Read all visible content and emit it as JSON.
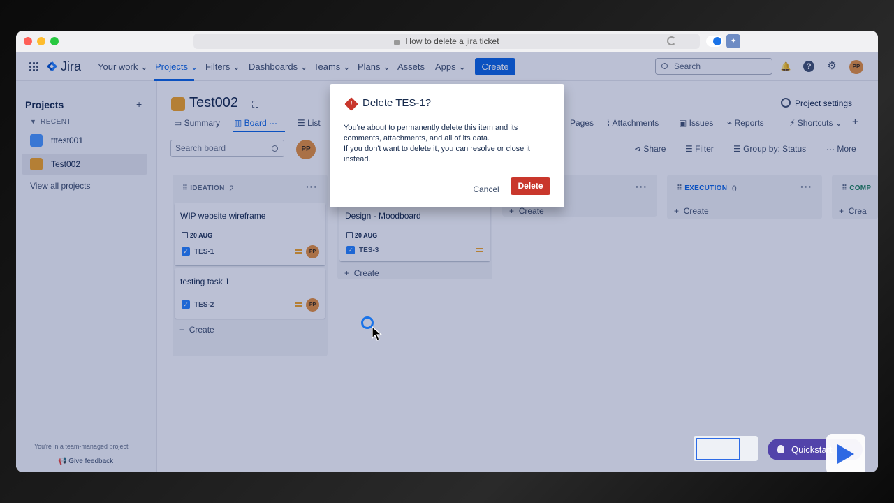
{
  "browser": {
    "url_title": "How to delete a jira ticket"
  },
  "topnav": {
    "logo": "Jira",
    "items": [
      "Your work",
      "Projects",
      "Filters",
      "Dashboards",
      "Teams",
      "Plans",
      "Assets",
      "Apps"
    ],
    "create_label": "Create",
    "search_placeholder": "Search",
    "avatar_initials": "PP"
  },
  "sidebar": {
    "title": "Projects",
    "add": "+",
    "recent_label": "RECENT",
    "projects": [
      "tttest001",
      "Test002"
    ],
    "view_all": "View all projects",
    "footer_note": "You're in a team-managed project",
    "feedback": "Give feedback"
  },
  "project": {
    "name": "Test002",
    "settings_label": "Project settings",
    "tabs": [
      "Summary",
      "Board",
      "List",
      "Pages",
      "Attachments",
      "Issues",
      "Reports",
      "Shortcuts"
    ],
    "board_search_placeholder": "Search board",
    "toolbar": [
      "Share",
      "Filter",
      "Group by: Status",
      "More"
    ]
  },
  "columns": [
    {
      "name": "IDEATION",
      "count": "2",
      "cards": [
        {
          "title": "WIP website wireframe",
          "date": "20 AUG",
          "key": "TES-1",
          "avatar": "PP"
        },
        {
          "title": "testing task 1",
          "date": "",
          "key": "TES-2",
          "avatar": "PP"
        }
      ],
      "create_label": "Create"
    },
    {
      "name": "",
      "count": "",
      "cards": [
        {
          "title": "Design - Moodboard",
          "date": "20 AUG",
          "key": "TES-3",
          "avatar": ""
        }
      ],
      "create_label": "Create"
    },
    {
      "name": "",
      "count": "",
      "cards": [],
      "create_label": "Create"
    },
    {
      "name": "EXECUTION",
      "count": "0",
      "cards": [],
      "create_label": "Create"
    },
    {
      "name": "COMP",
      "count": "",
      "cards": [],
      "create_label": "Crea"
    }
  ],
  "dialog": {
    "title": "Delete TES-1?",
    "body_line1": "You're about to permanently delete this item and its comments, attachments, and all of its data.",
    "body_line2": "If you don't want to delete it, you can resolve or close it instead.",
    "cancel_label": "Cancel",
    "delete_label": "Delete"
  },
  "quickstart": {
    "label": "Quickstart"
  },
  "colors": {
    "primary": "#0c66e4",
    "danger": "#c9372c",
    "avatar": "#e8923c",
    "quickstart": "#5243aa"
  }
}
